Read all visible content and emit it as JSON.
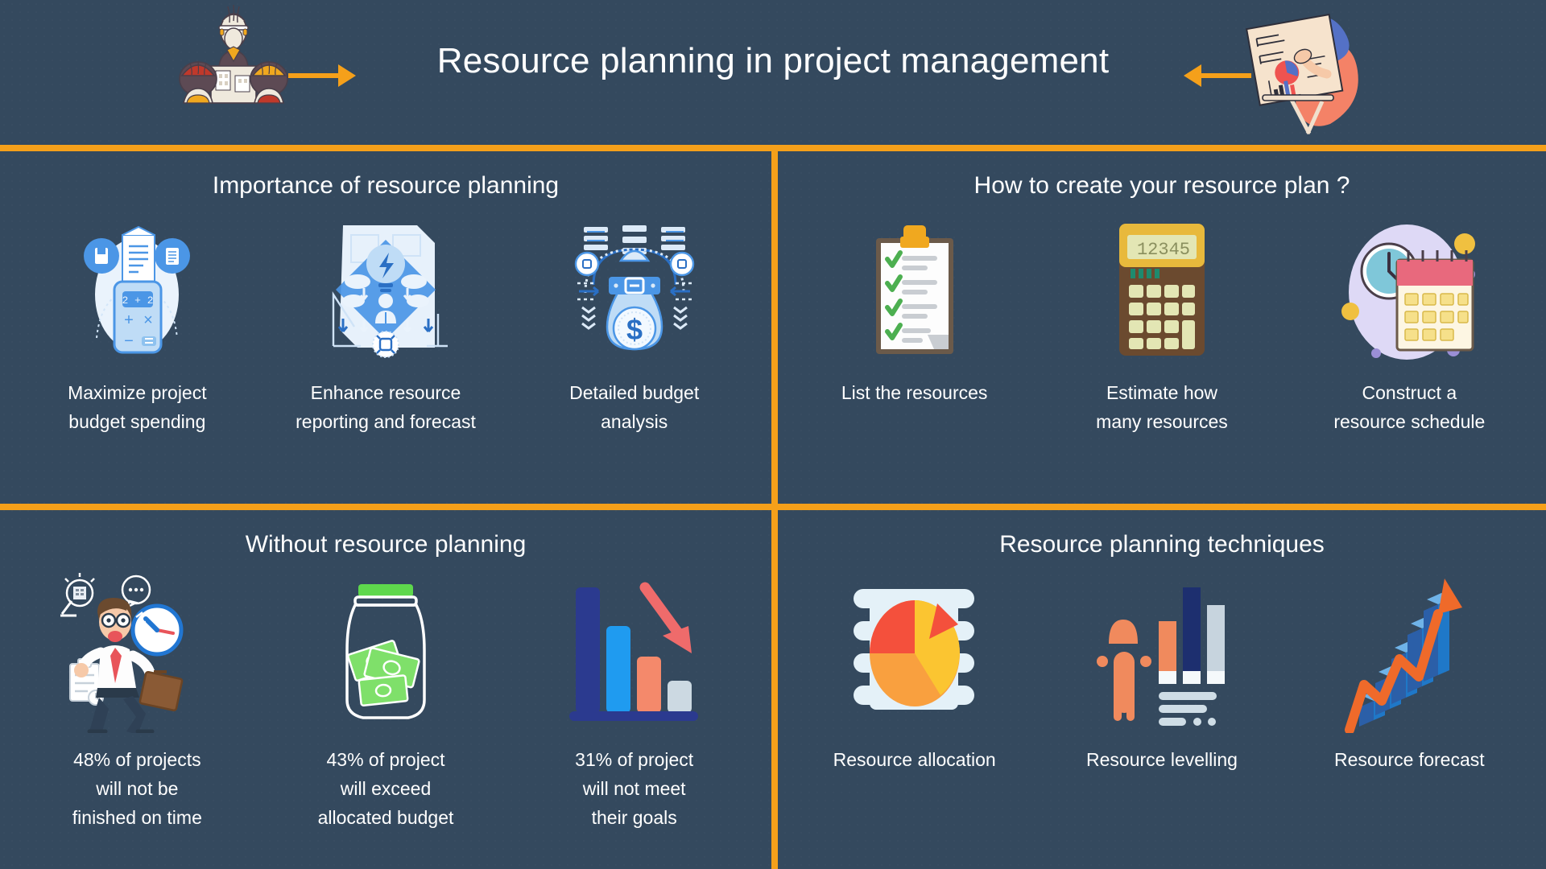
{
  "colors": {
    "background": "#34495e",
    "divider": "#f5a01a",
    "text": "#ffffff",
    "accent_orange": "#f5a01a",
    "icon_blue": "#2f80ed",
    "icon_light_blue": "#bcd9f5"
  },
  "header": {
    "title": "Resource planning in project management",
    "left_art": "engineers-with-blueprint-illustration",
    "right_art": "person-presenting-flipchart-illustration",
    "left_arrow": "arrow-right-icon",
    "right_arrow": "arrow-left-icon"
  },
  "quadrants": [
    {
      "id": "importance",
      "title": "Importance of resource planning",
      "items": [
        {
          "icon": "calculator-receipt-icon",
          "label": "Maximize project\nbudget spending"
        },
        {
          "icon": "lightbulb-network-forecast-icon",
          "label": "Enhance resource\nreporting and forecast"
        },
        {
          "icon": "money-bag-dollar-icon",
          "label": "Detailed budget\nanalysis"
        }
      ]
    },
    {
      "id": "how-to-create",
      "title": "How to create your resource plan ?",
      "items": [
        {
          "icon": "clipboard-checklist-icon",
          "label": "List the resources"
        },
        {
          "icon": "calculator-icon",
          "label": "Estimate how\nmany resources",
          "display": "12345"
        },
        {
          "icon": "clock-calendar-icon",
          "label": "Construct a\nresource schedule"
        }
      ]
    },
    {
      "id": "without-planning",
      "title": "Without resource planning",
      "items": [
        {
          "icon": "stressed-businessman-running-icon",
          "label": "48% of projects\nwill not be\nfinished on time"
        },
        {
          "icon": "money-jar-icon",
          "label": "43% of project\nwill exceed\nallocated budget"
        },
        {
          "icon": "declining-bar-chart-icon",
          "label": "31% of project\nwill not meet\ntheir goals"
        }
      ]
    },
    {
      "id": "techniques",
      "title": "Resource planning techniques",
      "items": [
        {
          "icon": "pie-chart-allocation-icon",
          "label": "Resource allocation"
        },
        {
          "icon": "person-bar-chart-levelling-icon",
          "label": "Resource levelling"
        },
        {
          "icon": "rising-arrow-bar-chart-icon",
          "label": "Resource forecast"
        }
      ]
    }
  ]
}
